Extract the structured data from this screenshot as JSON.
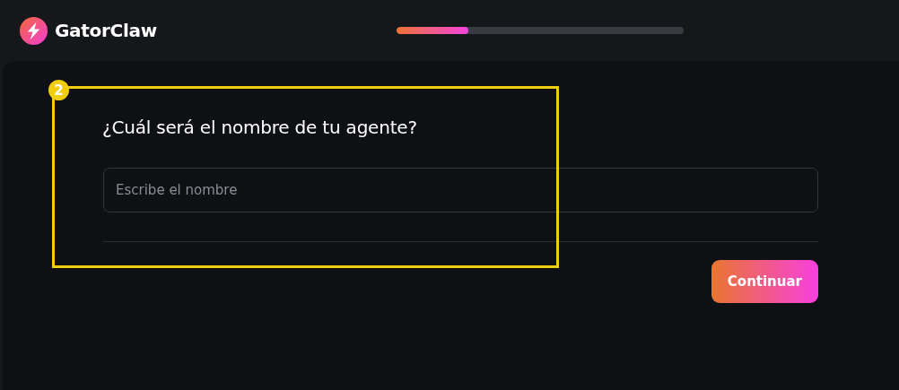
{
  "header": {
    "brand": "GatorClaw",
    "progress": {
      "level": 0.25
    }
  },
  "form": {
    "question": "¿Cuál será el nombre de tu agente?",
    "name_field": {
      "placeholder": "Escribe el nombre"
    },
    "submit": "Continuar"
  },
  "annotation": {
    "label": "2"
  }
}
